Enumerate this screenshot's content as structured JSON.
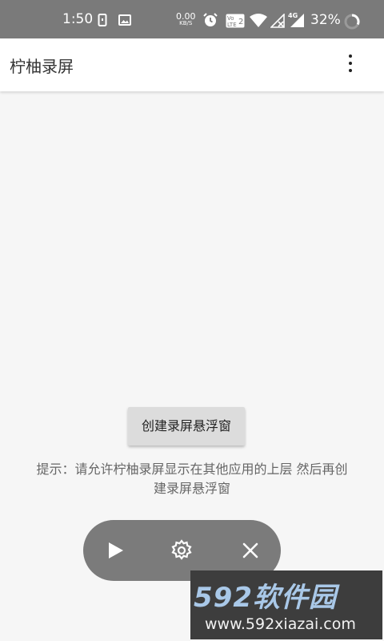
{
  "status_bar": {
    "time": "1:50",
    "net_speed_value": "0.00",
    "net_speed_unit": "KB/S",
    "volte_label": "VoLTE",
    "network_type": "4G",
    "battery_percent": "32%"
  },
  "toolbar": {
    "title": "柠柚录屏",
    "menu_icon": "more-vert-icon"
  },
  "main": {
    "create_button_label": "创建录屏悬浮窗",
    "hint_text": "提示：请允许柠柚录屏显示在其他应用的上层 然后再创建录屏悬浮窗"
  },
  "float_bar": {
    "buttons": [
      "play-icon",
      "settings-icon",
      "close-icon"
    ]
  },
  "watermark": {
    "brand": "592软件园",
    "url": "www.592xiazai.com"
  },
  "colors": {
    "status_bar_bg": "#7a7a7a",
    "toolbar_bg": "#ffffff",
    "page_bg": "#f6f6f6",
    "float_bar_bg": "#7b7b7b",
    "button_bg": "#dcdcdc"
  }
}
